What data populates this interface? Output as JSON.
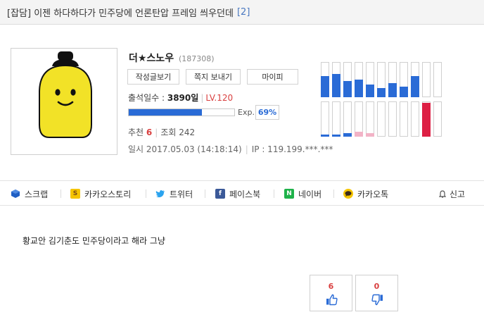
{
  "post": {
    "title": "[잡담] 이젠 하다하다가 민주당에 언론탄압 프레임 씌우던데",
    "comment_count": "[2]",
    "body": "황교안 김기춘도 민주당이라고 해라 그냥"
  },
  "author": {
    "nickname": "더★스노우",
    "user_no": "(187308)",
    "buttons": [
      "작성글보기",
      "쪽지 보내기",
      "마이피"
    ],
    "attendance_label": "출석일수 :",
    "attendance_value": "3890일",
    "level": "LV.120",
    "exp_label": "Exp.",
    "exp_percent_text": "69%",
    "exp_fraction": 0.69,
    "recommend_label": "추천",
    "recommend_value": "6",
    "views_label": "조회",
    "views_value": "242",
    "date": "일시 2017.05.03 (14:18:14)",
    "ip": "IP : 119.199.***.***"
  },
  "activity_chart": {
    "top_row": [
      0.6,
      0.65,
      0.45,
      0.5,
      0.35,
      0.25,
      0.4,
      0.3,
      0.6,
      0,
      0
    ],
    "bottom_row": [
      0.05,
      0.05,
      0.1,
      0.14,
      0.1,
      0,
      0,
      0,
      0,
      0.95,
      0
    ],
    "bottom_colors": [
      "#2a6bd6",
      "#2a6bd6",
      "#2a6bd6",
      "#f2b3c6",
      "#f2b3c6",
      "",
      "",
      "",
      "",
      "#dd1f44",
      ""
    ],
    "top_color": "#2a6bd6"
  },
  "share": {
    "scrap": "스크랩",
    "kakaostory": "카카오스토리",
    "twitter": "트위터",
    "facebook": "페이스북",
    "naver": "네이버",
    "kakaotalk": "카카오톡",
    "report": "신고"
  },
  "votes": {
    "up": "6",
    "down": "0"
  }
}
